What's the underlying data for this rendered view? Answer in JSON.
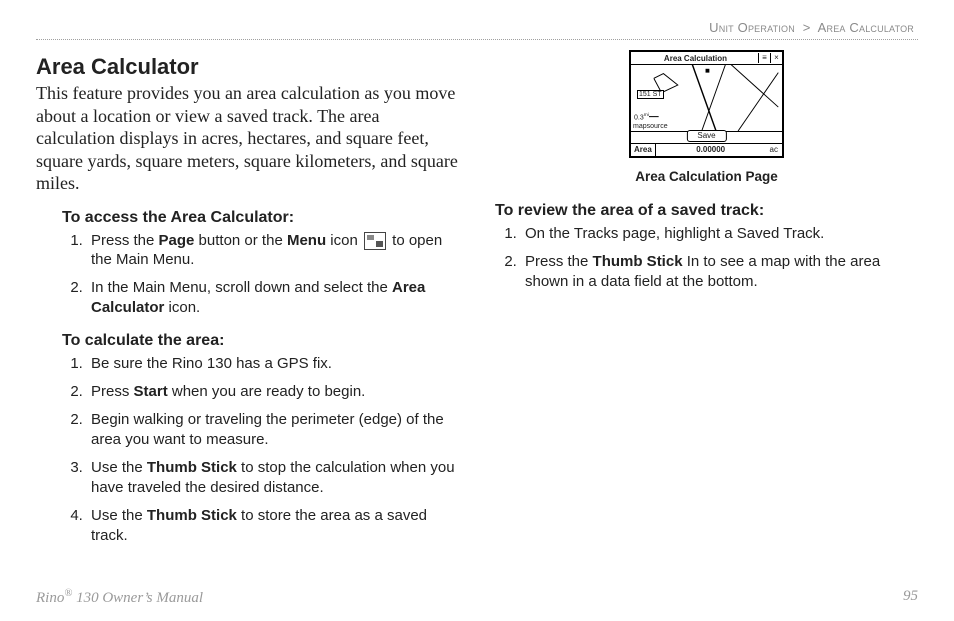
{
  "breadcrumb": {
    "section": "Unit Operation",
    "sep": ">",
    "page": "Area Calculator"
  },
  "title": "Area Calculator",
  "intro": "This feature provides you an area calculation as you move about a location or view a saved track. The area calculation displays in acres, hectares, and square feet, square yards, square meters, square kilometers, and square miles.",
  "sections": {
    "access": {
      "heading": "To access the Area Calculator:",
      "steps": [
        {
          "n": "1",
          "pre": "Press the ",
          "b1": "Page",
          "mid": " button or the ",
          "b2": "Menu",
          "post_icon": " icon ",
          "tail": " to open the Main Menu."
        },
        {
          "n": "2",
          "pre": "In the Main Menu, scroll down and select the ",
          "b1": "Area Calculator",
          "tail": " icon."
        }
      ]
    },
    "calc": {
      "heading": "To calculate the area:",
      "steps": [
        {
          "n": "1",
          "text": "Be sure the Rino 130 has a GPS fix."
        },
        {
          "n": "2",
          "pre": "Press ",
          "b1": "Start",
          "tail": " when you are ready to begin."
        },
        {
          "n": "2",
          "text": "Begin walking or traveling the perimeter (edge) of the area you want to measure."
        },
        {
          "n": "3",
          "pre": "Use the ",
          "b1": "Thumb Stick",
          "tail": " to stop the calculation when you have traveled the desired distance."
        },
        {
          "n": "4",
          "pre": "Use the ",
          "b1": "Thumb Stick",
          "tail": " to store the area as a saved track."
        }
      ]
    },
    "review": {
      "heading": "To review the area of a saved track:",
      "steps": [
        {
          "n": "1",
          "text": "On the Tracks page, highlight a Saved Track."
        },
        {
          "n": "2",
          "pre": "Press the ",
          "b1": "Thumb Stick",
          "tail": " In to see a map with the area shown in a data field at the bottom."
        }
      ]
    }
  },
  "device": {
    "title": "Area Calculation",
    "icon_menu": "≡",
    "icon_close": "×",
    "street": "151 ST",
    "scale": "0.3",
    "scale_unit": "mi",
    "map_source": "mapsource",
    "save": "Save",
    "area_label": "Area",
    "area_value": "0.00000",
    "area_unit": "ac",
    "caption": "Area Calculation Page"
  },
  "footer": {
    "manual_pre": "Rino",
    "manual_reg": "®",
    "manual_post": " 130 Owner’s Manual",
    "page_number": "95"
  }
}
